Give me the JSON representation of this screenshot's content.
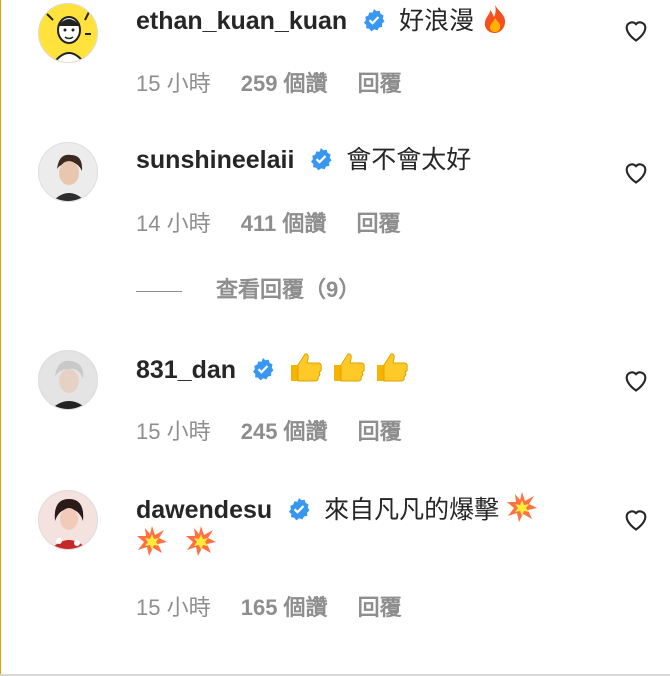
{
  "comments": [
    {
      "username": "ethan_kuan_kuan",
      "text": "好浪漫",
      "emojis": [
        "fire"
      ],
      "time": "15 小時",
      "likes": "259 個讚",
      "reply": "回覆"
    },
    {
      "username": "sunshineelaii",
      "text": "會不會太好",
      "emojis": [],
      "time": "14 小時",
      "likes": "411 個讚",
      "reply": "回覆"
    },
    {
      "username": "831_dan",
      "text": "",
      "emojis": [
        "thumbs-up",
        "thumbs-up",
        "thumbs-up"
      ],
      "time": "15 小時",
      "likes": "245 個讚",
      "reply": "回覆"
    },
    {
      "username": "dawendesu",
      "text": "來自凡凡的爆擊",
      "emojis": [
        "collision",
        "collision",
        "collision"
      ],
      "time": "15 小時",
      "likes": "165 個讚",
      "reply": "回覆"
    }
  ],
  "view_replies": "查看回覆（9）",
  "colors": {
    "verified": "#3897f0",
    "meta": "#8e8e8e",
    "text": "#262626"
  }
}
